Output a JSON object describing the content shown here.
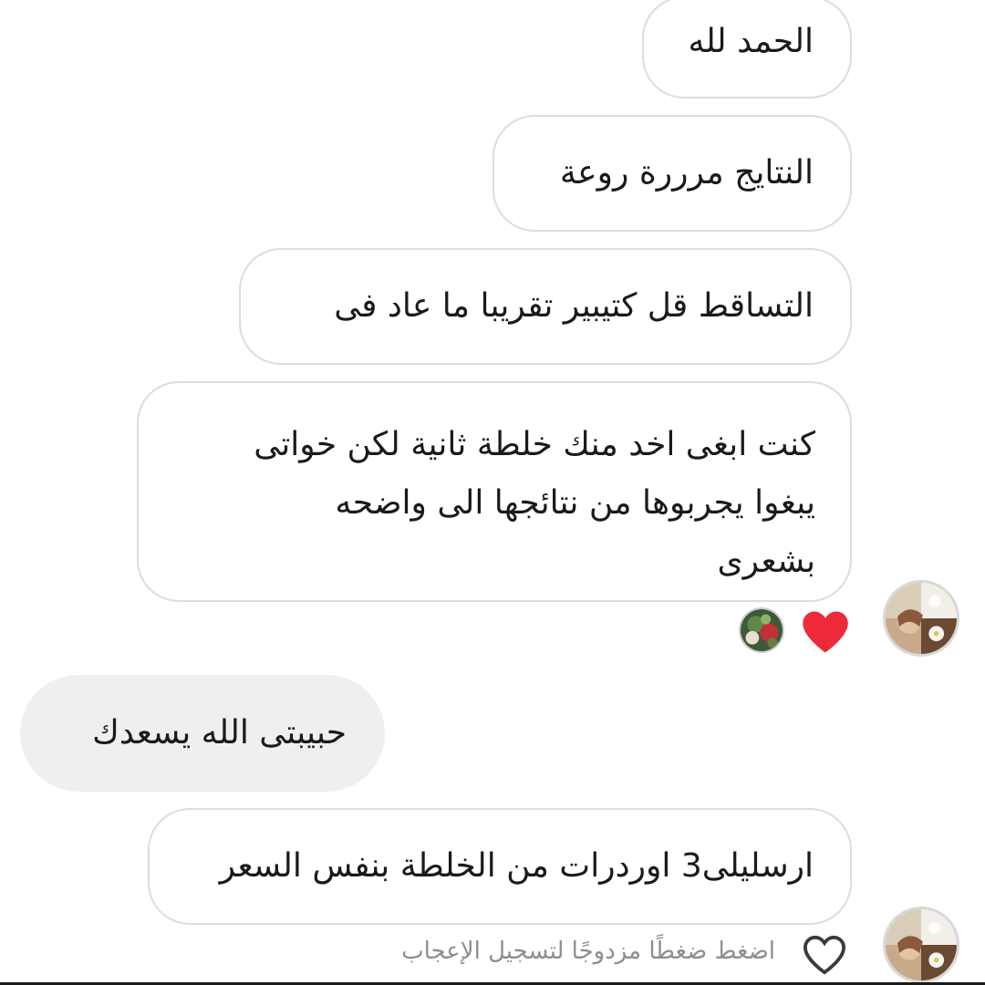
{
  "chat": {
    "messages": [
      {
        "text": "الحمد لله",
        "direction": "incoming"
      },
      {
        "text": "النتايج مرررة روعة",
        "direction": "incoming"
      },
      {
        "text": "التساقط قل كتيبير تقريبا ما عاد فى",
        "direction": "incoming"
      },
      {
        "text": "كنت ابغى اخد منك خلطة ثانية لكن خواتى\nيبغوا يجربوها من نتائجها الى واضحه\nبشعرى",
        "direction": "incoming"
      },
      {
        "text": "حبيبتى الله يسعدك",
        "direction": "outgoing"
      },
      {
        "text": "ارسليلى3 اوردرات من الخلطة بنفس السعر",
        "direction": "incoming"
      }
    ],
    "reaction": {
      "icon": "red-heart-icon",
      "color": "#ee2a3a"
    },
    "like_hint": "اضغط ضغطًا مزدوجًا لتسجيل الإعجاب",
    "icons": {
      "contact_avatar": "contact-avatar-icon",
      "reactor_avatar": "reactor-avatar-icon",
      "like": "heart-outline-icon"
    },
    "colors": {
      "incoming_bg": "#ffffff",
      "incoming_border": "#dcdcdc",
      "outgoing_bg": "#efefef",
      "hint_text": "#8e8e8e"
    }
  }
}
